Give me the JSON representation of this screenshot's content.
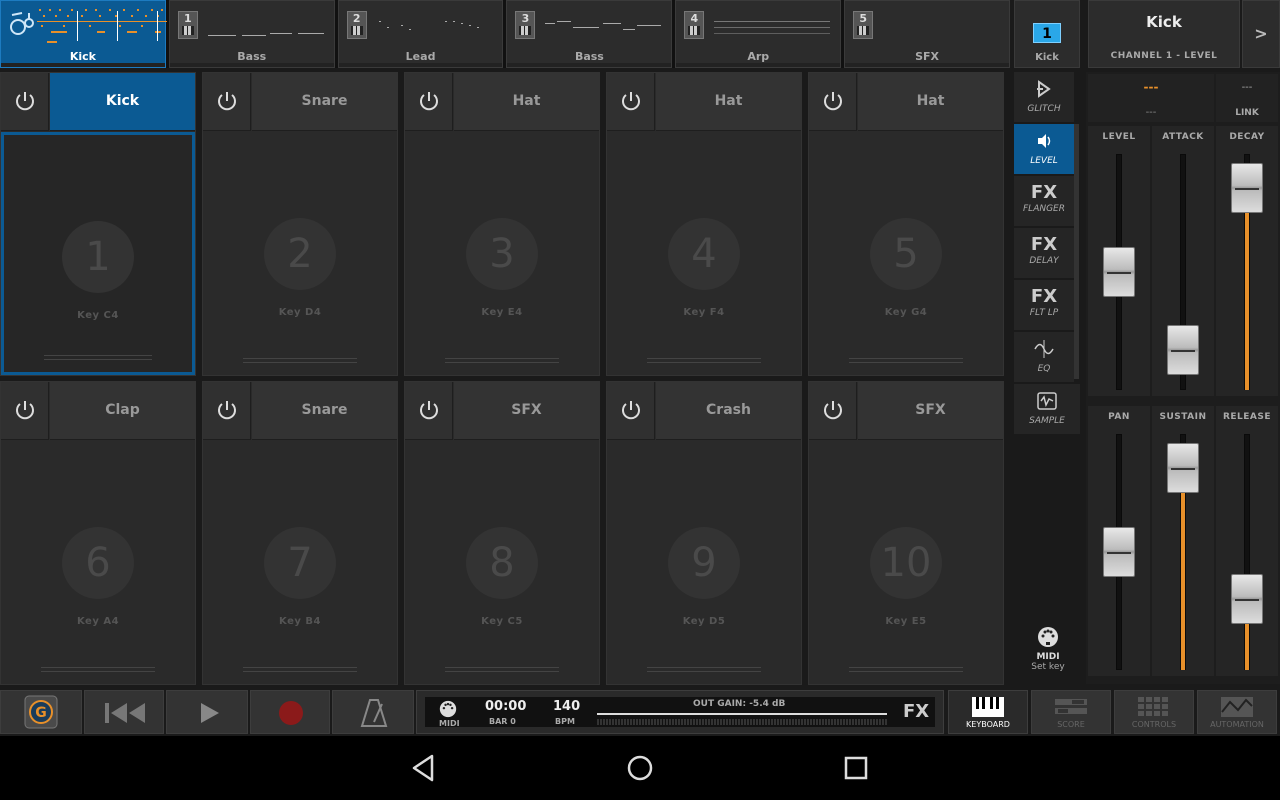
{
  "tracks": [
    {
      "num": "",
      "label": "Kick",
      "active": true
    },
    {
      "num": "1",
      "label": "Bass"
    },
    {
      "num": "2",
      "label": "Lead"
    },
    {
      "num": "3",
      "label": "Bass"
    },
    {
      "num": "4",
      "label": "Arp"
    },
    {
      "num": "5",
      "label": "SFX"
    }
  ],
  "channel": {
    "number": "1",
    "label": "Kick"
  },
  "instrument": {
    "name": "Kick",
    "subtitle": "CHANNEL 1 - LEVEL",
    "next_label": ">"
  },
  "pads": [
    {
      "name": "Kick",
      "number": "1",
      "key": "Key C4"
    },
    {
      "name": "Snare",
      "number": "2",
      "key": "Key D4"
    },
    {
      "name": "Hat",
      "number": "3",
      "key": "Key E4"
    },
    {
      "name": "Hat",
      "number": "4",
      "key": "Key F4"
    },
    {
      "name": "Hat",
      "number": "5",
      "key": "Key G4"
    },
    {
      "name": "Clap",
      "number": "6",
      "key": "Key A4"
    },
    {
      "name": "Snare",
      "number": "7",
      "key": "Key B4"
    },
    {
      "name": "SFX",
      "number": "8",
      "key": "Key C5"
    },
    {
      "name": "Crash",
      "number": "9",
      "key": "Key D5"
    },
    {
      "name": "SFX",
      "number": "10",
      "key": "Key E5"
    }
  ],
  "fx_column": [
    {
      "big": "",
      "caption": "GLITCH"
    },
    {
      "big": "",
      "caption": "LEVEL",
      "active": true
    },
    {
      "big": "FX",
      "caption": "FLANGER"
    },
    {
      "big": "FX",
      "caption": "DELAY"
    },
    {
      "big": "FX",
      "caption": "FLT LP"
    },
    {
      "big": "",
      "caption": "EQ"
    },
    {
      "big": "",
      "caption": "SAMPLE"
    }
  ],
  "midi_set": {
    "title": "MIDI",
    "subtitle": "Set key"
  },
  "right_panel": {
    "top_value": "---",
    "top_sub": "---",
    "link_value": "---",
    "link_label": "LINK",
    "faders": [
      {
        "title": "LEVEL",
        "level": 0.5,
        "filled": false
      },
      {
        "title": "ATTACK",
        "level": 0.08,
        "filled": false
      },
      {
        "title": "DECAY",
        "level": 0.95,
        "filled": true
      },
      {
        "title": "PAN",
        "level": 0.5,
        "filled": false
      },
      {
        "title": "SUSTAIN",
        "level": 0.95,
        "filled": true
      },
      {
        "title": "RELEASE",
        "level": 0.25,
        "filled": true
      }
    ]
  },
  "transport": {
    "midi_label": "MIDI",
    "time": "00:00",
    "bar": "BAR 0",
    "bpm_value": "140",
    "bpm_label": "BPM",
    "gain": "OUT GAIN: -5.4 dB",
    "fx_label": "FX"
  },
  "modes": [
    {
      "label": "KEYBOARD",
      "active": true
    },
    {
      "label": "SCORE"
    },
    {
      "label": "CONTROLS"
    },
    {
      "label": "AUTOMATION"
    }
  ],
  "colors": {
    "accent": "#0b5a93",
    "highlight": "#2aa7e8",
    "orange": "#e8902a",
    "record": "#8b1a1a"
  }
}
